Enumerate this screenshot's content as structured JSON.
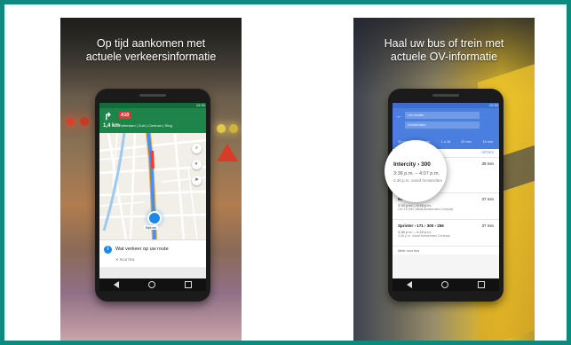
{
  "colors": {
    "frame_border": "#0d8a80",
    "maps_green": "#1e8449",
    "transit_blue": "#4a7fe0",
    "info_blue": "#1e88e5"
  },
  "panel1": {
    "caption_line1": "Op tijd aankomen met",
    "caption_line2": "actuele verkeersinformatie",
    "status_time": "12:30",
    "road_shield": "A10",
    "distance": "1,4 km",
    "destination": "Rotterdam | Zuid | Centrum | Ring",
    "location_label": "Bijlmer",
    "traffic_message": "Wat verkeer op uw route",
    "dismiss_label": "SLUITEN",
    "turn_icon": "turn-right-arrow",
    "search_icon": "search-icon",
    "sound_icon": "speaker-icon"
  },
  "panel2": {
    "caption_line1": "Haal uw bus of trein met",
    "caption_line2": "actuele OV-informatie",
    "status_time": "12:30",
    "from_field": "Uw locatie",
    "to_field": "Amsterdam",
    "modes": [
      "30 min.",
      "39 min.",
      "1 u 18",
      "29 min.",
      "16 min."
    ],
    "options_label": "OPTIES",
    "routes": [
      {
        "title": "Intercity  ›  300",
        "duration": "39 min",
        "time": "3:38 p.m. – 4:07 p.m.",
        "from": "3:38 p.m. vanaf Amsterdam Centraal"
      },
      {
        "title": "5a  ›  300",
        "duration": "37 min",
        "time": "3:39 p.m. – 4:16 p.m.",
        "from": "Om 15 min. vanaf Amsterdam Centraal"
      },
      {
        "title": "Sprinter  ›  171  ›  300  ›  256",
        "duration": "37 min",
        "time": "3:38 p.m. – 4:15 p.m.",
        "from": "3:38 p.m. vanaf Amsterdam Centraal"
      }
    ],
    "magnifier": {
      "title": "Intercity  ›  300",
      "time": "3:38 p.m. – 4:07 p.m.",
      "from": "3:38 p.m. vanaf Amsterdam"
    },
    "more_label": "Meer voor bus"
  }
}
